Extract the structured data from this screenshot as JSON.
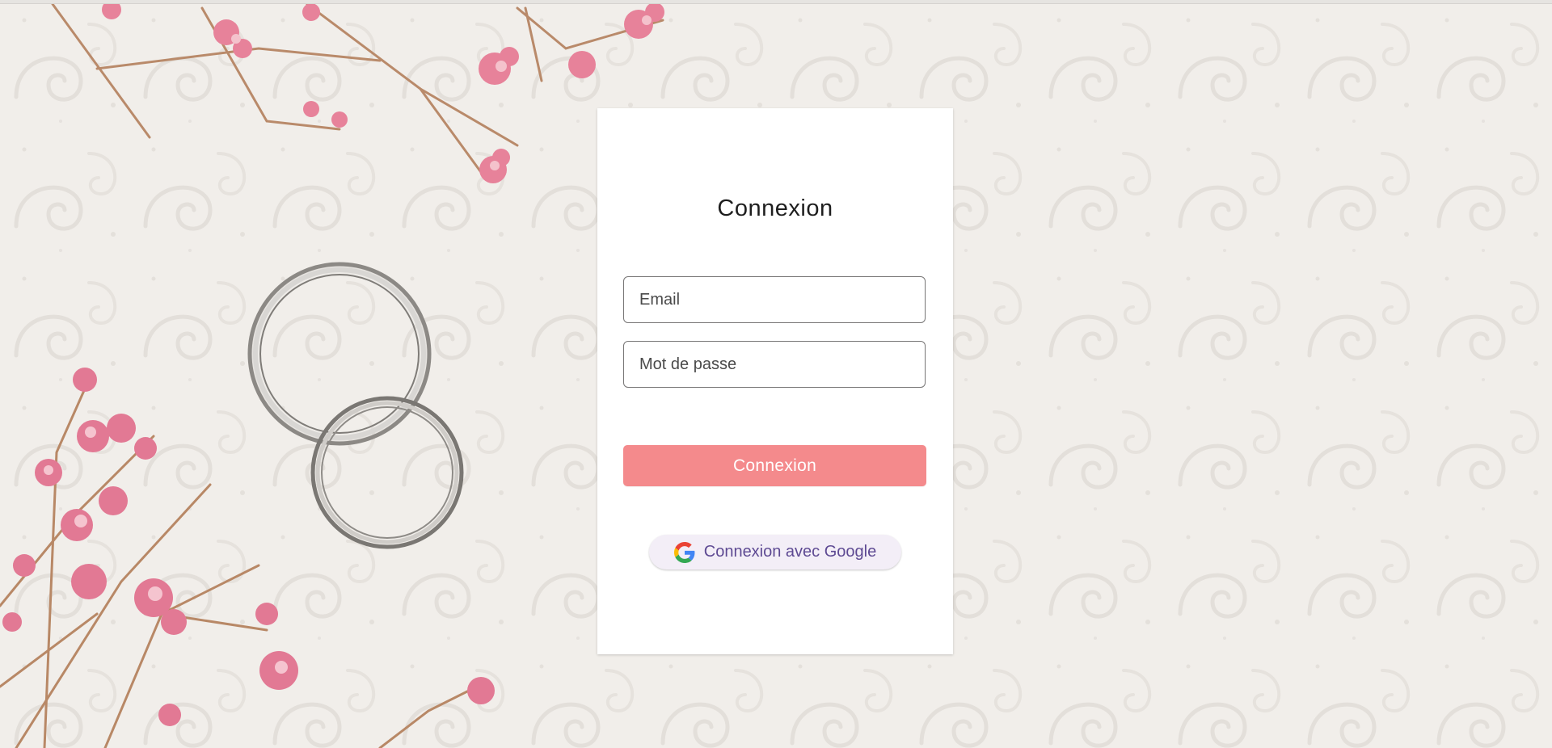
{
  "login": {
    "title": "Connexion",
    "email_placeholder": "Email",
    "password_placeholder": "Mot de passe",
    "submit_label": "Connexion",
    "google_label": "Connexion avec Google"
  },
  "colors": {
    "accent": "#f48a8c",
    "google_text": "#5e4a93",
    "background": "#f1eeea"
  },
  "icons": {
    "google": "google-g-icon"
  }
}
